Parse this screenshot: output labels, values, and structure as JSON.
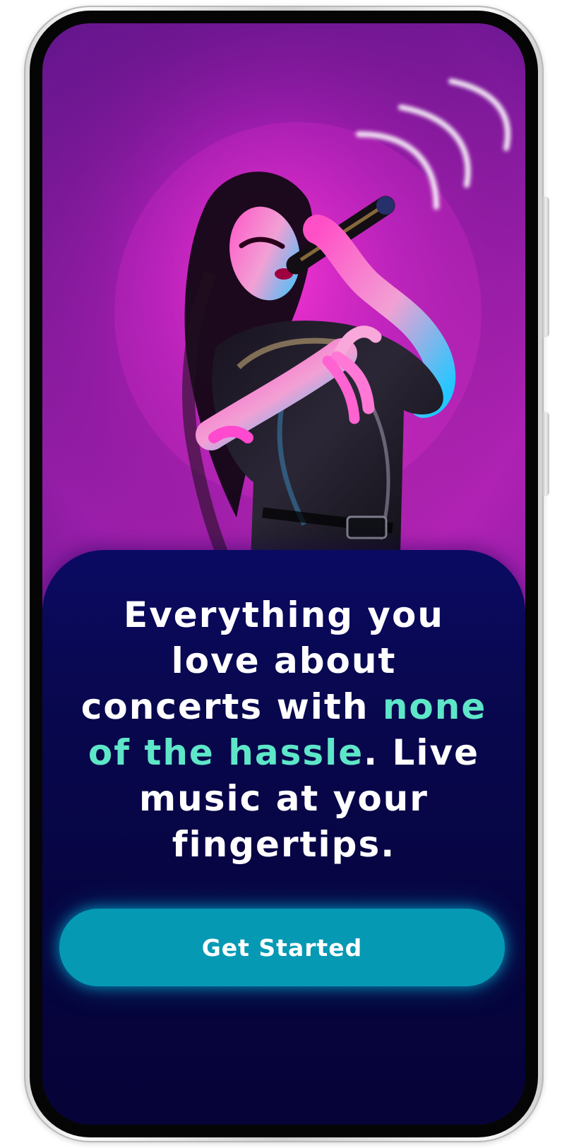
{
  "onboarding": {
    "headline": {
      "before": "Everything you love about concerts with ",
      "highlight": "none of the hassle",
      "after": ". Live music at your fingertips."
    },
    "cta_label": "Get Started"
  },
  "colors": {
    "accent": "#5ee6c8",
    "button": "#0699b4",
    "panel": "#070447"
  },
  "icons": {
    "sound_waves": "sound-waves-icon"
  }
}
